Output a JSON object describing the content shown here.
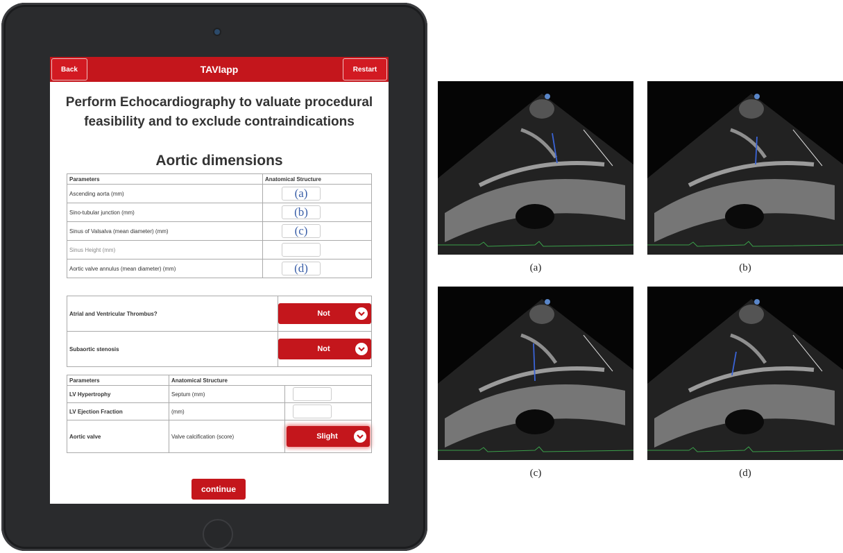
{
  "app": {
    "title": "TAVIapp",
    "back_label": "Back",
    "restart_label": "Restart",
    "heading": "Perform Echocardiography to valuate procedural feasibility and to exclude contraindications",
    "continue_label": "continue"
  },
  "aortic": {
    "title": "Aortic dimensions",
    "col_params": "Parameters",
    "col_structure": "Anatomical Structure",
    "rows": [
      {
        "label": "Ascending aorta (mm)",
        "tag": "(a)"
      },
      {
        "label": "Sino-tubular junction (mm)",
        "tag": "(b)"
      },
      {
        "label": "Sinus of Valsalva (mean diameter) (mm)",
        "tag": "(c)"
      },
      {
        "label": "Sinus Height (mm)",
        "tag": ""
      },
      {
        "label": "Aortic valve annulus (mean diameter) (mm)",
        "tag": "(d)"
      }
    ]
  },
  "questions": [
    {
      "label": "Atrial and Ventricular Thrombus?",
      "value": "Not"
    },
    {
      "label": "Subaortic stenosis",
      "value": "Not"
    }
  ],
  "lv": {
    "col_params": "Parameters",
    "col_structure": "Anatomical Structure",
    "rows": [
      {
        "label": "LV Hypertrophy",
        "structure": "Septum (mm)"
      },
      {
        "label": "LV Ejection Fraction",
        "structure": "(mm)"
      },
      {
        "label": "Aortic valve",
        "structure": "Valve calcification (score)",
        "value": "Slight"
      }
    ]
  },
  "images": {
    "captions": [
      "(a)",
      "(b)",
      "(c)",
      "(d)"
    ]
  },
  "colors": {
    "accent": "#c4161c",
    "tag_blue": "#3a5fa8"
  }
}
